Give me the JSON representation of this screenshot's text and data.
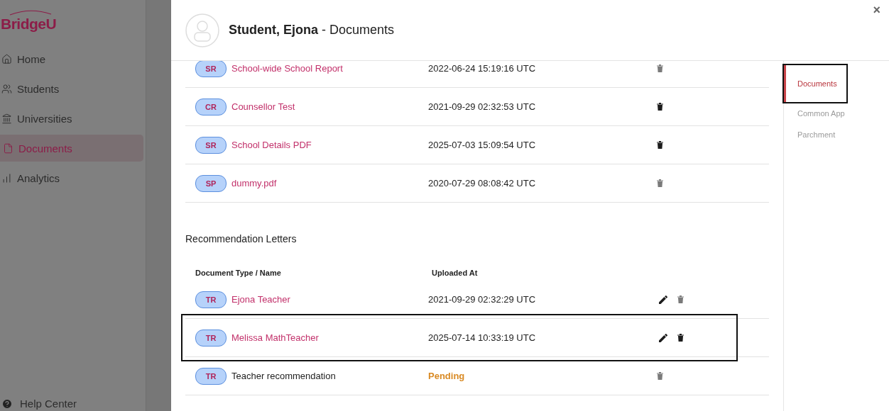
{
  "sidebar": {
    "logo": "BridgeU",
    "items": [
      {
        "label": "Home",
        "selected": false
      },
      {
        "label": "Students",
        "selected": false
      },
      {
        "label": "Universities",
        "selected": false
      },
      {
        "label": "Documents",
        "selected": true
      },
      {
        "label": "Analytics",
        "selected": false
      }
    ],
    "footer": "Help Center"
  },
  "modal": {
    "title": "**Student, Ejona** - Documents",
    "close": "×",
    "documents": [
      {
        "type": "SR",
        "name": "School-wide School Report",
        "uploaded_at": "2022-06-24 15:19:16 UTC",
        "kind": "uploaded",
        "editable": false,
        "deletable": false,
        "highlighted": false
      },
      {
        "type": "CR",
        "name": "Counsellor Test",
        "uploaded_at": "2021-09-29 02:32:53 UTC",
        "kind": "uploaded",
        "editable": false,
        "deletable": true,
        "highlighted": false
      },
      {
        "type": "SR",
        "name": "School Details PDF",
        "uploaded_at": "2025-07-03 15:09:54 UTC",
        "kind": "uploaded",
        "editable": false,
        "deletable": true,
        "highlighted": false
      },
      {
        "type": "SP",
        "name": "dummy.pdf",
        "uploaded_at": "2020-07-29 08:08:42 UTC",
        "kind": "uploaded",
        "editable": false,
        "deletable": false,
        "highlighted": false
      }
    ],
    "recommendations": {
      "heading": "Recommendation Letters",
      "columns": [
        "Document Type / Name",
        "Uploaded At"
      ],
      "rows": [
        {
          "type": "TR",
          "name": "Ejona Teacher",
          "uploaded_at": "2021-09-29 02:32:29 UTC",
          "kind": "uploaded",
          "editable": true,
          "deletable": false,
          "highlighted": false
        },
        {
          "type": "TR",
          "name": "Melissa MathTeacher",
          "uploaded_at": "2025-07-14 10:33:19 UTC",
          "kind": "uploaded",
          "editable": true,
          "deletable": true,
          "highlighted": true
        },
        {
          "type": "TR",
          "name": "Teacher recommendation",
          "uploaded_at": "Pending",
          "kind": "pending",
          "editable": false,
          "deletable": false,
          "highlighted": false
        }
      ]
    },
    "tabs": [
      {
        "label": "Documents",
        "selected": true,
        "highlighted": true
      },
      {
        "label": "Common App",
        "selected": false,
        "highlighted": false
      },
      {
        "label": "Parchment",
        "selected": false,
        "highlighted": false
      }
    ]
  }
}
